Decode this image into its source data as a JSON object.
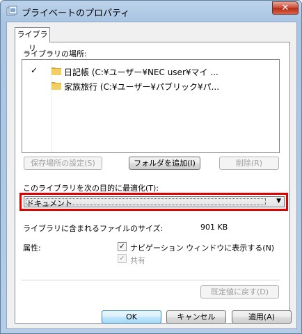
{
  "window": {
    "title": "プライベートのプロパティ",
    "close_label": "✕"
  },
  "tab": {
    "label": "ライブラリ"
  },
  "locations": {
    "heading": "ライブラリの場所:",
    "items": [
      {
        "checked": "✓",
        "text": "日記帳 (C:¥ユーザー¥NEC user¥マイ ..."
      },
      {
        "checked": "",
        "text": "家族旅行 (C:¥ユーザー¥パブリック¥パ..."
      }
    ],
    "buttons": {
      "set_save_location": "保存場所の設定(S)",
      "add_folder": "フォルダを追加(I)",
      "remove": "削除(R)"
    }
  },
  "optimize": {
    "label": "このライブラリを次の目的に最適化(T):",
    "selected": "ドキュメント",
    "arrow": "▼"
  },
  "size": {
    "label": "ライブラリに含まれるファイルのサイズ:",
    "value": "901 KB"
  },
  "attributes": {
    "label": "属性:",
    "show_in_nav": {
      "checked": "✓",
      "label": "ナビゲーション ウィンドウに表示する(N)"
    },
    "shared": {
      "checked": "✓",
      "label": "共有"
    }
  },
  "restore_defaults": "既定値に戻す(D)",
  "footer": {
    "ok": "OK",
    "cancel": "キャンセル",
    "apply": "適用(A)"
  },
  "colors": {
    "highlight_border": "#e00000",
    "title_bar": "#bcd3ea"
  }
}
